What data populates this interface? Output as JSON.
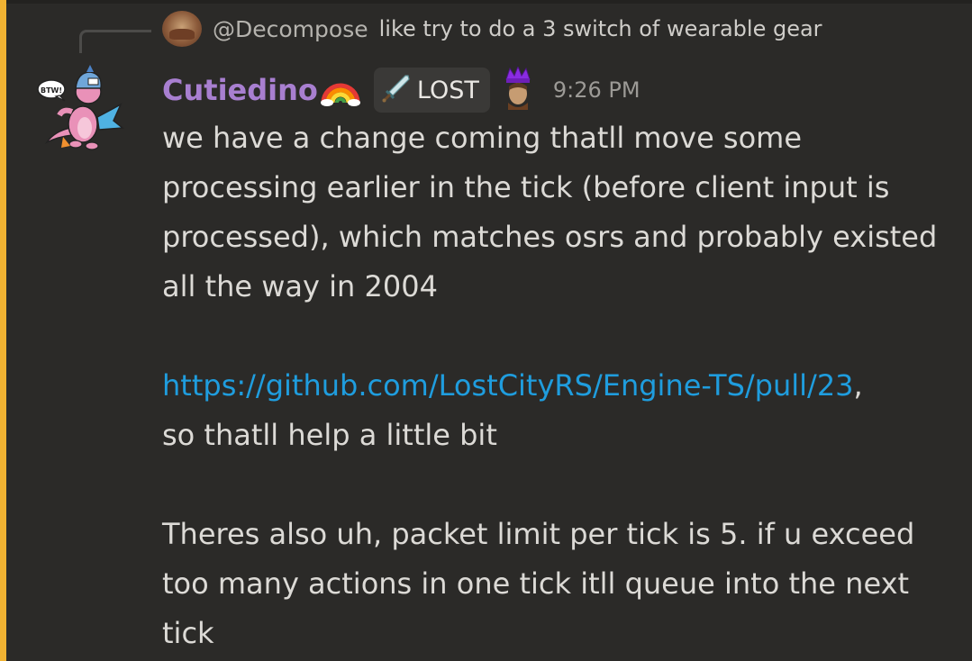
{
  "reply": {
    "author": "@Decompose",
    "text": "like try to do a 3 switch of wearable gear"
  },
  "message": {
    "author": "Cutiedino",
    "author_emoji": "rainbow-icon",
    "tag": {
      "icon": "sword-icon",
      "label": "LOST"
    },
    "badge": "crown-icon",
    "timestamp": "9:26 PM",
    "avatar_text": "BTW!",
    "paragraph1": "we have a change coming thatll move some processing earlier in the tick (before client input is processed), which matches osrs and probably existed all the way in 2004",
    "link": "https://github.com/LostCityRS/Engine-TS/pull/23",
    "link_suffix": ",",
    "paragraph2_rest": "so thatll help a little bit",
    "paragraph3": "Theres also uh, packet limit per tick is 5. if u exceed too many actions in one tick itll queue into the next tick"
  },
  "colors": {
    "highlight": "#f0b232",
    "username": "#a87fd0",
    "link": "#1f9dde",
    "background": "#2b2a28"
  }
}
